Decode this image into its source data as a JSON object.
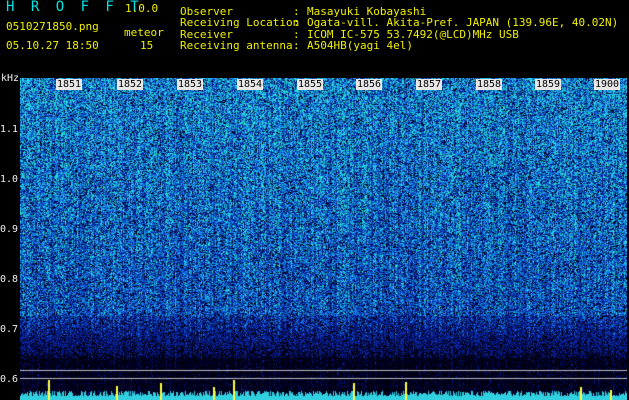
{
  "header": {
    "app_title": "H R O F F T",
    "app_version": "1.0.0",
    "file_name": "0510271850.png",
    "date_time": "05.10.27 18:50",
    "count_label": "meteor",
    "count_value": "15"
  },
  "info": [
    {
      "label": "Observer",
      "value": "Masayuki Kobayashi"
    },
    {
      "label": "Receiving Location",
      "value": "Ogata-vill. Akita-Pref. JAPAN (139.96E, 40.02N)"
    },
    {
      "label": "Receiver",
      "value": "ICOM IC-575 53.7492(@LCD)MHz USB"
    },
    {
      "label": "Receiving antenna",
      "value": "A504HB(yagi 4el)"
    }
  ],
  "spectrogram": {
    "freq_unit": "kHz",
    "freq_ticks": [
      "1.1",
      "1.0",
      "0.9",
      "0.8",
      "0.7",
      "0.6"
    ],
    "time_ticks": [
      "1851",
      "1852",
      "1853",
      "1854",
      "1855",
      "1856",
      "1857",
      "1858",
      "1859",
      "1900"
    ],
    "colors": {
      "background": "#000000",
      "signal_low": "#0a1a8c",
      "signal_mid": "#2060ff",
      "signal_high": "#40e0e0",
      "spike": "#ffff40"
    }
  }
}
